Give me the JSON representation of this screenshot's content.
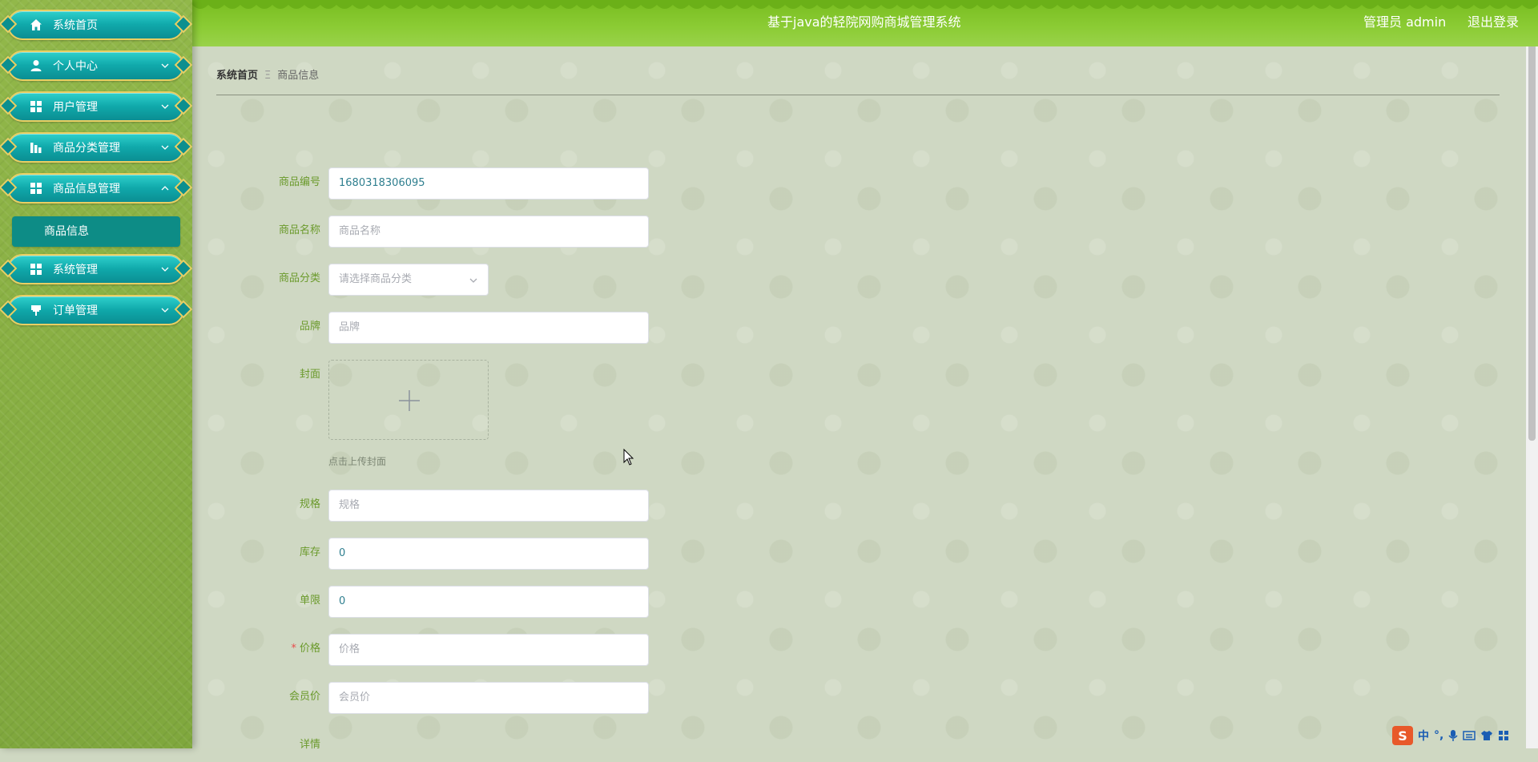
{
  "header": {
    "title": "基于java的轻院网购商城管理系统",
    "role": "管理员 admin",
    "logout": "退出登录"
  },
  "sidebar": {
    "items": [
      {
        "label": "系统首页",
        "icon": "home-icon"
      },
      {
        "label": "个人中心",
        "icon": "user-icon"
      },
      {
        "label": "用户管理",
        "icon": "grid-icon"
      },
      {
        "label": "商品分类管理",
        "icon": "bar-chart-icon"
      },
      {
        "label": "商品信息管理",
        "icon": "grid-icon",
        "expanded": true
      },
      {
        "label": "系统管理",
        "icon": "grid-icon"
      },
      {
        "label": "订单管理",
        "icon": "pin-icon"
      }
    ],
    "active_sub": "商品信息"
  },
  "breadcrumb": {
    "home": "系统首页",
    "sep": "Ξ",
    "current": "商品信息"
  },
  "form": {
    "code": {
      "label": "商品编号",
      "value": "1680318306095"
    },
    "name": {
      "label": "商品名称",
      "placeholder": "商品名称"
    },
    "category": {
      "label": "商品分类",
      "placeholder": "请选择商品分类"
    },
    "brand": {
      "label": "品牌",
      "placeholder": "品牌"
    },
    "cover": {
      "label": "封面",
      "hint": "点击上传封面"
    },
    "spec": {
      "label": "规格",
      "placeholder": "规格"
    },
    "stock": {
      "label": "库存",
      "value": "0"
    },
    "limit": {
      "label": "单限",
      "value": "0"
    },
    "price": {
      "label": "价格",
      "required": "*",
      "placeholder": "价格"
    },
    "member_price": {
      "label": "会员价",
      "placeholder": "会员价"
    },
    "detail": {
      "label": "详情"
    }
  },
  "ime": {
    "logo": "S",
    "lang": "中",
    "punct": "°,"
  },
  "colors": {
    "header_green": "#8ccc35",
    "sidebar_green": "#7fa73d",
    "menu_teal": "#10a9ab",
    "menu_gold_border": "#e9cf63",
    "label_green": "#6b9a2c",
    "active_sub_teal": "#0d8c86"
  }
}
